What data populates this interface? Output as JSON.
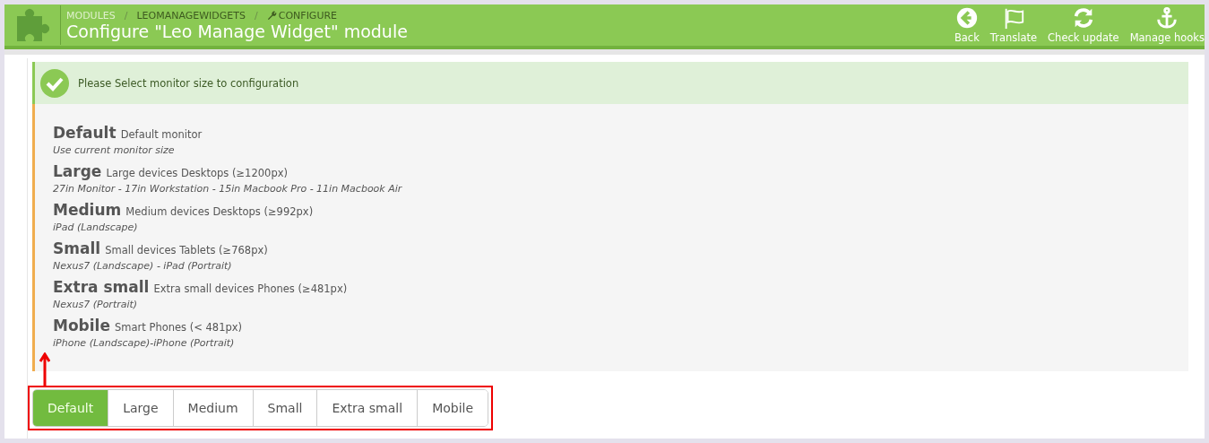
{
  "header": {
    "separator": "/",
    "breadcrumb": [
      "MODULES",
      "LEOMANAGEWIDGETS",
      "CONFIGURE"
    ],
    "title": "Configure \"Leo Manage Widget\" module",
    "actions": [
      {
        "label": "Back",
        "kind": "back"
      },
      {
        "label": "Translate",
        "kind": "flag"
      },
      {
        "label": "Check update",
        "kind": "refresh"
      },
      {
        "label": "Manage hooks",
        "kind": "anchor"
      }
    ]
  },
  "alert": {
    "message": "Please Select monitor size to configuration"
  },
  "sizes": [
    {
      "name": "Default",
      "desc": "Default monitor",
      "devices": "Use current monitor size"
    },
    {
      "name": "Large",
      "desc": "Large devices Desktops (≥1200px)",
      "devices": "27in Monitor - 17in Workstation - 15in Macbook Pro - 11in Macbook Air"
    },
    {
      "name": "Medium",
      "desc": "Medium devices Desktops (≥992px)",
      "devices": "iPad (Landscape)"
    },
    {
      "name": "Small",
      "desc": "Small devices Tablets (≥768px)",
      "devices": "Nexus7 (Landscape) - iPad (Portrait)"
    },
    {
      "name": "Extra small",
      "desc": "Extra small devices Phones (≥481px)",
      "devices": "Nexus7 (Portrait)"
    },
    {
      "name": "Mobile",
      "desc": "Smart Phones (< 481px)",
      "devices": "iPhone (Landscape)-iPhone (Portrait)"
    }
  ],
  "tabs": [
    {
      "label": "Default",
      "selected": true
    },
    {
      "label": "Large",
      "selected": false
    },
    {
      "label": "Medium",
      "selected": false
    },
    {
      "label": "Small",
      "selected": false
    },
    {
      "label": "Extra small",
      "selected": false
    },
    {
      "label": "Mobile",
      "selected": false
    }
  ]
}
